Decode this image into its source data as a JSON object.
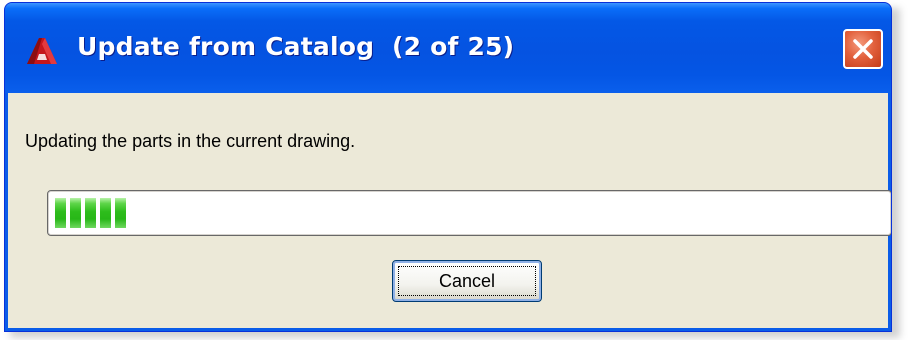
{
  "window": {
    "title": "Update from Catalog  (2 of 25)",
    "app_icon": "autocad-logo-icon",
    "close_icon": "close-icon"
  },
  "dialog": {
    "message": "Updating the parts in the current drawing.",
    "progress": {
      "current": 2,
      "total": 25,
      "filled_chunks": 5
    },
    "cancel_label": "Cancel"
  },
  "colors": {
    "titlebar": "#0553e1",
    "client_background": "#ece9d8",
    "progress_fill": "#2ebd1c",
    "close_button": "#e2613d"
  }
}
